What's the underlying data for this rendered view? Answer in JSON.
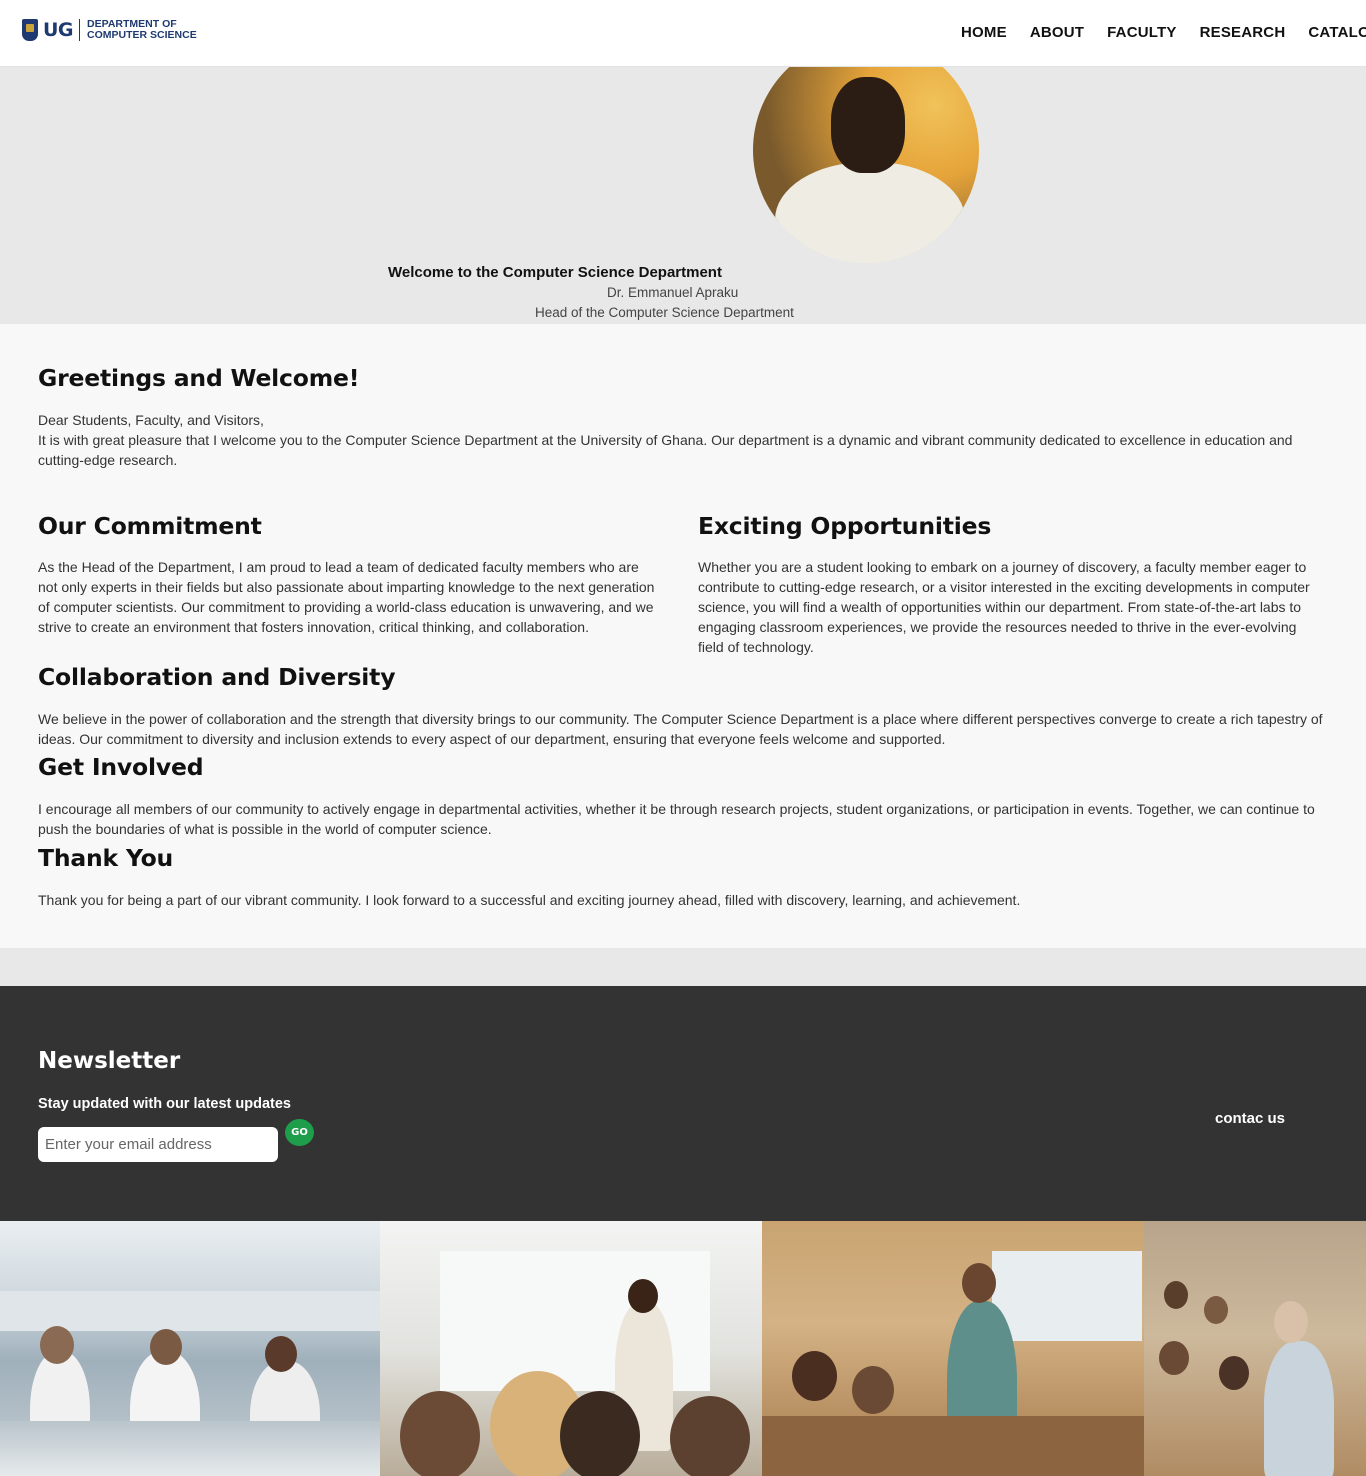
{
  "header": {
    "logo": {
      "mark": "UG",
      "line1": "DEPARTMENT OF",
      "line2": "COMPUTER SCIENCE"
    },
    "nav": [
      "HOME",
      "ABOUT",
      "FACULTY",
      "RESEARCH",
      "CATALOG"
    ]
  },
  "hero": {
    "title": "Welcome to the Computer Science Department",
    "name": "Dr. Emmanuel Apraku",
    "role": "Head of the Computer Science Department"
  },
  "content": {
    "greeting_heading": "Greetings and Welcome!",
    "greeting_salutation": "Dear Students, Faculty, and Visitors,",
    "greeting_body": "It is with great pleasure that I welcome you to the Computer Science Department at the University of Ghana. Our department is a dynamic and vibrant community dedicated to excellence in education and cutting-edge research.",
    "commitment_heading": "Our Commitment",
    "commitment_body": "As the Head of the Department, I am proud to lead a team of dedicated faculty members who are not only experts in their fields but also passionate about imparting knowledge to the next generation of computer scientists. Our commitment to providing a world-class education is unwavering, and we strive to create an environment that fosters innovation, critical thinking, and collaboration.",
    "opportunities_heading": "Exciting Opportunities",
    "opportunities_body": "Whether you are a student looking to embark on a journey of discovery, a faculty member eager to contribute to cutting-edge research, or a visitor interested in the exciting developments in computer science, you will find a wealth of opportunities within our department. From state-of-the-art labs to engaging classroom experiences, we provide the resources needed to thrive in the ever-evolving field of technology.",
    "collaboration_heading": "Collaboration and Diversity",
    "collaboration_body": "We believe in the power of collaboration and the strength that diversity brings to our community. The Computer Science Department is a place where different perspectives converge to create a rich tapestry of ideas. Our commitment to diversity and inclusion extends to every aspect of our department, ensuring that everyone feels welcome and supported.",
    "involved_heading": "Get Involved",
    "involved_body": "I encourage all members of our community to actively engage in departmental activities, whether it be through research projects, student organizations, or participation in events. Together, we can continue to push the boundaries of what is possible in the world of computer science.",
    "thanks_heading": "Thank You",
    "thanks_body": "Thank you for being a part of our vibrant community. I look forward to a successful and exciting journey ahead, filled with discovery, learning, and achievement."
  },
  "footer": {
    "newsletter_title": "Newsletter",
    "newsletter_sub": "Stay updated with our latest updates",
    "email_placeholder": "Enter your email address",
    "go_label": "GO",
    "contact_label": "contac us"
  },
  "colors": {
    "brand_navy": "#1f3a70",
    "go_green": "#1e9e4a",
    "footer_bg": "#333333",
    "hero_bg": "#e7e8e7"
  }
}
